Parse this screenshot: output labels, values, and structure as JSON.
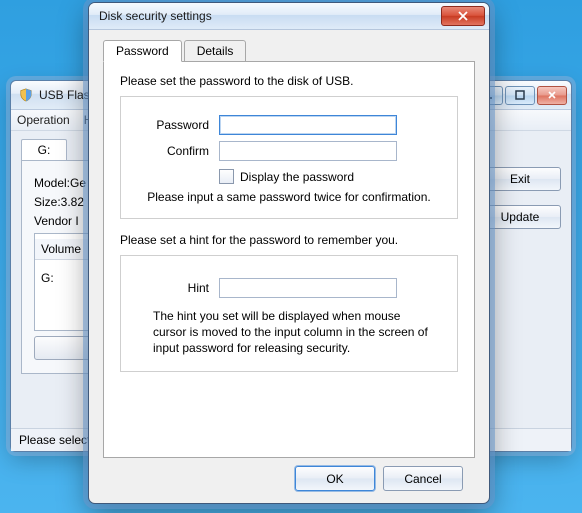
{
  "parent_window": {
    "title": "USB Flash S",
    "menu": {
      "operation": "Operation",
      "help": "H"
    },
    "drive_tab": "G:",
    "info": {
      "model": "Model:Ge",
      "size": "Size:3.82",
      "vendor": "Vendor I"
    },
    "volume_label": "Volume",
    "volume_value": "G:",
    "buttons": {
      "exit": "Exit",
      "update": "Update"
    },
    "status": "Please select a"
  },
  "dialog": {
    "title": "Disk security settings",
    "tabs": {
      "password": "Password",
      "details": "Details"
    },
    "section1": {
      "heading": "Please set the password to the disk of USB.",
      "password_label": "Password",
      "confirm_label": "Confirm",
      "display_pw": "Display the password",
      "note": "Please input a same password twice for confirmation."
    },
    "section2": {
      "heading": "Please set a hint for the password to remember you.",
      "hint_label": "Hint",
      "explain": "The hint you set will be displayed when mouse cursor is moved to the input column in the screen of input password for releasing security."
    },
    "buttons": {
      "ok": "OK",
      "cancel": "Cancel"
    }
  }
}
